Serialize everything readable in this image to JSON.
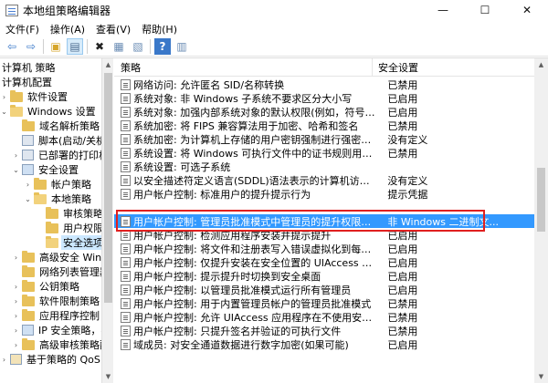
{
  "window": {
    "title": "本地组策略编辑器",
    "controls": {
      "minimize": "—",
      "maximize": "☐",
      "close": "✕"
    }
  },
  "menu": [
    "文件(F)",
    "操作(A)",
    "查看(V)",
    "帮助(H)"
  ],
  "toolbar": {
    "buttons": [
      {
        "icon": "back-arrow-icon",
        "glyph": "⇦"
      },
      {
        "icon": "forward-arrow-icon",
        "glyph": "⇨"
      },
      {
        "icon": "up-folder-icon",
        "glyph": "▣"
      },
      {
        "icon": "show-hide-tree-icon",
        "glyph": "▤"
      },
      {
        "icon": "delete-icon",
        "glyph": "✖"
      },
      {
        "icon": "properties-icon",
        "glyph": "▦"
      },
      {
        "icon": "export-list-icon",
        "glyph": "▧"
      },
      {
        "icon": "help-icon",
        "glyph": "?"
      },
      {
        "icon": "show-pane-icon",
        "glyph": "▥"
      }
    ]
  },
  "tree": {
    "items": [
      {
        "label": "计算机 策略",
        "icon": "computer",
        "twisty": ""
      },
      {
        "label": "计算机配置",
        "icon": "computer",
        "twisty": ""
      },
      {
        "label": "软件设置",
        "icon": "folder",
        "twisty": "›"
      },
      {
        "label": "Windows 设置",
        "icon": "folder-open",
        "twisty": "⌄"
      },
      {
        "label": "域名解析策略",
        "icon": "folder",
        "twisty": ""
      },
      {
        "label": "脚本(启动/关机)",
        "icon": "script",
        "twisty": ""
      },
      {
        "label": "已部署的打印机",
        "icon": "printer",
        "twisty": "›"
      },
      {
        "label": "安全设置",
        "icon": "shield",
        "twisty": "⌄"
      },
      {
        "label": "帐户策略",
        "icon": "folder",
        "twisty": "›"
      },
      {
        "label": "本地策略",
        "icon": "folder-open",
        "twisty": "⌄"
      },
      {
        "label": "审核策略",
        "icon": "folder",
        "twisty": ""
      },
      {
        "label": "用户权限分配",
        "icon": "folder",
        "twisty": ""
      },
      {
        "label": "安全选项",
        "icon": "folder-open",
        "twisty": ""
      },
      {
        "label": "高级安全 Windo",
        "icon": "folder",
        "twisty": "›"
      },
      {
        "label": "网络列表管理器",
        "icon": "folder",
        "twisty": ""
      },
      {
        "label": "公钥策略",
        "icon": "folder",
        "twisty": "›"
      },
      {
        "label": "软件限制策略",
        "icon": "folder",
        "twisty": "›"
      },
      {
        "label": "应用程序控制",
        "icon": "folder",
        "twisty": "›"
      },
      {
        "label": "IP 安全策略，在",
        "icon": "shield",
        "twisty": "›"
      },
      {
        "label": "高级审核策略配",
        "icon": "folder",
        "twisty": "›"
      },
      {
        "label": "基于策略的 QoS",
        "icon": "chart",
        "twisty": "›"
      }
    ]
  },
  "list": {
    "columns": {
      "policy": "策略",
      "setting": "安全设置"
    },
    "rows": [
      {
        "policy": "网络访问: 允许匿名 SID/名称转换",
        "setting": "已禁用"
      },
      {
        "policy": "系统对象: 非 Windows 子系统不要求区分大小写",
        "setting": "已启用"
      },
      {
        "policy": "系统对象: 加强内部系统对象的默认权限(例如，符号链接)",
        "setting": "已启用"
      },
      {
        "policy": "系统加密: 将 FIPS 兼容算法用于加密、哈希和签名",
        "setting": "已禁用"
      },
      {
        "policy": "系统加密: 为计算机上存储的用户密钥强制进行强密钥保护",
        "setting": "没有定义"
      },
      {
        "policy": "系统设置: 将 Windows 可执行文件中的证书规则用于软件...",
        "setting": "已禁用"
      },
      {
        "policy": "系统设置: 可选子系统",
        "setting": ""
      },
      {
        "policy": "以安全描述符定义语言(SDDL)语法表示的计算机访问限制",
        "setting": "没有定义"
      },
      {
        "policy": "用户帐户控制: 标准用户的提升提示行为",
        "setting": "提示凭据"
      },
      {
        "policy": "用户帐户控制: 管理员批准模式中管理员的提升权限提示的...",
        "setting": "非 Windows 二进制文..."
      },
      {
        "policy": "用户帐户控制: 检测应用程序安装并提示提升",
        "setting": "已启用"
      },
      {
        "policy": "用户帐户控制: 将文件和注册表写入错误虚拟化到每用户位置",
        "setting": "已启用"
      },
      {
        "policy": "用户帐户控制: 仅提升安装在安全位置的 UIAccess 应用程序",
        "setting": "已启用"
      },
      {
        "policy": "用户帐户控制: 提示提升时切换到安全桌面",
        "setting": "已启用"
      },
      {
        "policy": "用户帐户控制: 以管理员批准模式运行所有管理员",
        "setting": "已启用"
      },
      {
        "policy": "用户帐户控制: 用于内置管理员帐户的管理员批准模式",
        "setting": "已禁用"
      },
      {
        "policy": "用户帐户控制: 允许 UIAccess 应用程序在不使用安全桌面...",
        "setting": "已禁用"
      },
      {
        "policy": "用户帐户控制: 只提升签名并验证的可执行文件",
        "setting": "已禁用"
      },
      {
        "policy": "域成员: 对安全通道数据进行数字加密(如果可能)",
        "setting": "已启用"
      }
    ],
    "selected_row": 9
  },
  "colors": {
    "selection": "#3399ff",
    "tree_selection": "#cce8ff",
    "highlight_annotation": "#e02020"
  }
}
